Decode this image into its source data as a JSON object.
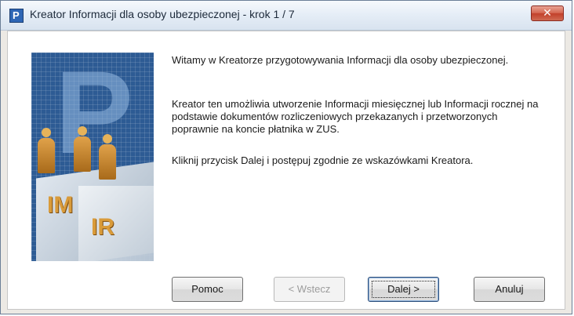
{
  "window": {
    "title": "Kreator Informacji dla osoby ubezpieczonej  - krok 1 / 7",
    "close_glyph": "✕",
    "app_icon_letter": "P"
  },
  "banner": {
    "top_letter": "P",
    "label_im": "IM",
    "label_ir": "IR"
  },
  "content": {
    "paragraphs": [
      "Witamy w Kreatorze przygotowywania Informacji dla osoby ubezpieczonej.",
      "Kreator ten umożliwia utworzenie Informacji miesięcznej lub Informacji rocznej na podstawie dokumentów rozliczeniowych przekazanych i przetworzonych poprawnie na koncie płatnika w ZUS.",
      "Kliknij przycisk Dalej i postępuj zgodnie ze wskazówkami Kreatora."
    ]
  },
  "buttons": {
    "help": "Pomoc",
    "back": "< Wstecz",
    "next": "Dalej >",
    "cancel": "Anuluj"
  }
}
